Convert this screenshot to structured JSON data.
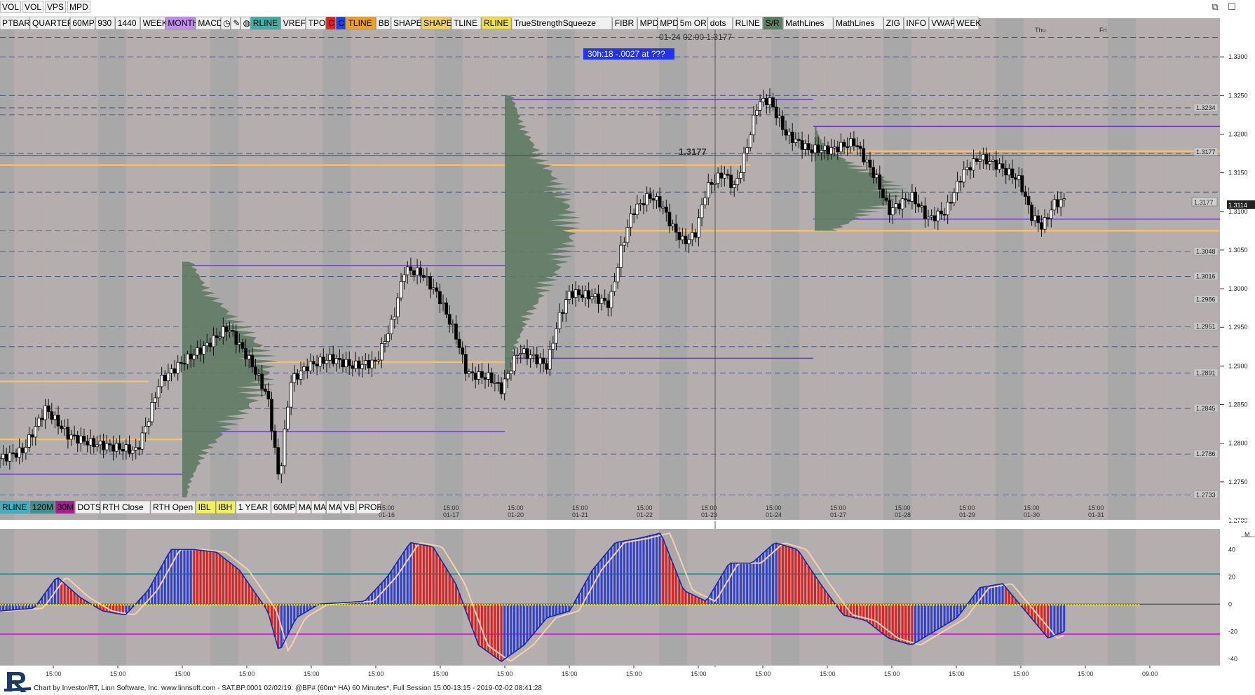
{
  "menubar": {
    "items": [
      "VOL",
      "VOL",
      "VPS",
      "MPD"
    ]
  },
  "toolbar_top": [
    {
      "label": "PTBAR",
      "bg": "#f0f0f0"
    },
    {
      "label": "QUARTER",
      "bg": "#f0f0f0"
    },
    {
      "label": "60MP",
      "bg": "#f0f0f0"
    },
    {
      "label": "930",
      "bg": "#f0f0f0"
    },
    {
      "label": "1440",
      "bg": "#f0f0f0"
    },
    {
      "label": "WEEK",
      "bg": "#f0f0f0"
    },
    {
      "label": "MONTH",
      "bg": "#c58cf0"
    },
    {
      "label": "MACD",
      "bg": "#f0f0f0"
    },
    {
      "label": "◷",
      "bg": "#f0f0f0"
    },
    {
      "label": "✎",
      "bg": "#f0f0f0"
    },
    {
      "label": "◍",
      "bg": "#f0f0f0"
    },
    {
      "label": "RLINE",
      "bg": "#3fb0a8"
    },
    {
      "label": "VREF",
      "bg": "#f0f0f0"
    },
    {
      "label": "TPO",
      "bg": "#f0f0f0"
    },
    {
      "label": "C",
      "bg": "#e02020"
    },
    {
      "label": "C",
      "bg": "#2040e0"
    },
    {
      "label": "TLINE",
      "bg": "#f0a020"
    },
    {
      "label": "BB",
      "bg": "#f0f0f0"
    },
    {
      "label": "SHAPE",
      "bg": "#f0f0f0"
    },
    {
      "label": "SHAPE",
      "bg": "#f0d060"
    },
    {
      "label": "TLINE",
      "bg": "#f0f0f0"
    },
    {
      "label": "RLINE",
      "bg": "#f0e040"
    },
    {
      "label": "TrueStrengthSqueeze",
      "bg": "#f0f0f0"
    },
    {
      "label": "FIBR",
      "bg": "#f0f0f0"
    },
    {
      "label": "MPD",
      "bg": "#f0f0f0"
    },
    {
      "label": "MPD",
      "bg": "#f0f0f0"
    },
    {
      "label": "5m OR",
      "bg": "#f0f0f0"
    },
    {
      "label": "dots",
      "bg": "#f0f0f0"
    },
    {
      "label": "RLINE",
      "bg": "#f0f0f0"
    },
    {
      "label": "S/R",
      "bg": "#5a8060"
    },
    {
      "label": "MathLines",
      "bg": "#f0f0f0"
    },
    {
      "label": "MathLines",
      "bg": "#f0f0f0"
    },
    {
      "label": "ZIG",
      "bg": "#f0f0f0"
    },
    {
      "label": "INFO",
      "bg": "#f0f0f0"
    },
    {
      "label": "VWAP",
      "bg": "#f0f0f0"
    },
    {
      "label": "WEEK",
      "bg": "#f0f0f0"
    }
  ],
  "toolbar_bottom": [
    {
      "label": "RLINE",
      "bg": "#3fb0c0"
    },
    {
      "label": "120M",
      "bg": "#3f9090"
    },
    {
      "label": "30M",
      "bg": "#a02090"
    },
    {
      "label": "DOTS",
      "bg": "#f0f0f0"
    },
    {
      "label": "RTH Close",
      "bg": "#f0f0f0"
    },
    {
      "label": "RTH Open",
      "bg": "#f0f0f0"
    },
    {
      "label": "IBL",
      "bg": "#f0f060"
    },
    {
      "label": "IBH",
      "bg": "#f0f060"
    },
    {
      "label": "1 YEAR",
      "bg": "#f0f0f0"
    },
    {
      "label": "60MP",
      "bg": "#f0f0f0"
    },
    {
      "label": "MA",
      "bg": "#f0f0f0"
    },
    {
      "label": "MA",
      "bg": "#f0f0f0"
    },
    {
      "label": "MA",
      "bg": "#f0f0f0"
    },
    {
      "label": "VB",
      "bg": "#f0f0f0"
    },
    {
      "label": "PROF",
      "bg": "#f0f0f0"
    }
  ],
  "crosshair_readout": "01-24  02:00  1.3177",
  "info_box": "30h:18  -.0027 at ???",
  "crosshair_price_label": "1.3177",
  "current_price_label": "1.3114",
  "colors": {
    "price_bg": "#b4aeae",
    "shade_band": "#a8a8a8",
    "profile": "#5f7a64",
    "orange_line": "#f2c070",
    "purple_line": "#6a3cc8",
    "macd_up": "#3040d0",
    "macd_down": "#e02020",
    "zero_dots": "#f0f000",
    "teal_level": "#2f8f8f",
    "magenta_level": "#e020e0"
  },
  "footer_text": "Chart by Investor/RT, Linn Software, Inc. www.linnsoft.com - SAT.BP.0001  02/02/19: @BP# (60m* HA) 60 Minutes*, Full Session 15:00-13:15 - 2019-02-02 08:41:28",
  "chart_data": [
    {
      "type": "candlestick",
      "title": "",
      "ylim": [
        1.27,
        1.335
      ],
      "y_ticks": [
        "1.3300",
        "1.3250",
        "1.3200",
        "1.3150",
        "1.3100",
        "1.3050",
        "1.3000",
        "1.2950",
        "1.2900",
        "1.2850",
        "1.2800",
        "1.2750",
        "1.2700"
      ],
      "session_labels": [
        {
          "time": "15:00",
          "date": "01-16"
        },
        {
          "time": "15:00",
          "date": "01-17"
        },
        {
          "time": "15:00",
          "date": "01-20"
        },
        {
          "time": "15:00",
          "date": "01-21"
        },
        {
          "time": "15:00",
          "date": "01-22"
        },
        {
          "time": "15:00",
          "date": "01-23"
        },
        {
          "time": "15:00",
          "date": "01-24"
        },
        {
          "time": "15:00",
          "date": "01-27"
        },
        {
          "time": "15:00",
          "date": "01-28"
        },
        {
          "time": "15:00",
          "date": "01-29"
        },
        {
          "time": "15:00",
          "date": "01-30"
        },
        {
          "time": "15:00",
          "date": "01-31"
        }
      ],
      "weekday_labels": [
        "Thu",
        "Fri"
      ],
      "level_labels": [
        "1.3234",
        "1.3177",
        "1.3114",
        "1.3048",
        "1.3016",
        "1.2986",
        "1.2951",
        "1.2891",
        "1.2845",
        "1.2786",
        "1.2733"
      ],
      "close_path": [
        [
          0,
          1.278
        ],
        [
          0.02,
          1.279
        ],
        [
          0.04,
          1.2845
        ],
        [
          0.06,
          1.281
        ],
        [
          0.08,
          1.28
        ],
        [
          0.1,
          1.2795
        ],
        [
          0.12,
          1.279
        ],
        [
          0.13,
          1.283
        ],
        [
          0.14,
          1.288
        ],
        [
          0.16,
          1.2905
        ],
        [
          0.18,
          1.2925
        ],
        [
          0.2,
          1.295
        ],
        [
          0.22,
          1.2905
        ],
        [
          0.235,
          1.286
        ],
        [
          0.245,
          1.275
        ],
        [
          0.255,
          1.288
        ],
        [
          0.27,
          1.29
        ],
        [
          0.29,
          1.291
        ],
        [
          0.31,
          1.29
        ],
        [
          0.33,
          1.2905
        ],
        [
          0.345,
          1.296
        ],
        [
          0.355,
          1.3025
        ],
        [
          0.37,
          1.302
        ],
        [
          0.385,
          1.299
        ],
        [
          0.4,
          1.294
        ],
        [
          0.41,
          1.289
        ],
        [
          0.43,
          1.2885
        ],
        [
          0.44,
          1.287
        ],
        [
          0.455,
          1.292
        ],
        [
          0.47,
          1.291
        ],
        [
          0.48,
          1.29
        ],
        [
          0.49,
          1.296
        ],
        [
          0.5,
          1.2995
        ],
        [
          0.52,
          1.299
        ],
        [
          0.535,
          1.298
        ],
        [
          0.545,
          1.305
        ],
        [
          0.555,
          1.31
        ],
        [
          0.57,
          1.312
        ],
        [
          0.58,
          1.311
        ],
        [
          0.59,
          1.308
        ],
        [
          0.6,
          1.306
        ],
        [
          0.61,
          1.307
        ],
        [
          0.62,
          1.313
        ],
        [
          0.635,
          1.315
        ],
        [
          0.645,
          1.313
        ],
        [
          0.655,
          1.318
        ],
        [
          0.665,
          1.324
        ],
        [
          0.675,
          1.3245
        ],
        [
          0.69,
          1.32
        ],
        [
          0.71,
          1.318
        ],
        [
          0.73,
          1.318
        ],
        [
          0.75,
          1.319
        ],
        [
          0.77,
          1.314
        ],
        [
          0.78,
          1.31
        ],
        [
          0.8,
          1.312
        ],
        [
          0.815,
          1.309
        ],
        [
          0.83,
          1.31
        ],
        [
          0.845,
          1.315
        ],
        [
          0.86,
          1.317
        ],
        [
          0.875,
          1.316
        ],
        [
          0.885,
          1.315
        ],
        [
          0.895,
          1.314
        ],
        [
          0.905,
          1.3095
        ],
        [
          0.915,
          1.308
        ],
        [
          0.925,
          1.311
        ],
        [
          0.934,
          1.3114
        ]
      ]
    },
    {
      "type": "bar",
      "title": "",
      "ylim": [
        -45,
        55
      ],
      "y_ticks": [
        "40",
        "20",
        "0",
        "-20",
        "-40"
      ],
      "levels": [
        22,
        -22
      ],
      "x_time_labels": [
        "15:00",
        "15:00",
        "15:00",
        "15:00",
        "15:00",
        "15:00",
        "15:00",
        "15:00",
        "15:00",
        "15:00",
        "15:00",
        "15:00",
        "15:00",
        "15:00",
        "15:00",
        "15:00",
        "15:00",
        "09:00"
      ],
      "series_path": [
        [
          0,
          -5
        ],
        [
          0.03,
          -3
        ],
        [
          0.05,
          20
        ],
        [
          0.07,
          5
        ],
        [
          0.09,
          -5
        ],
        [
          0.11,
          -8
        ],
        [
          0.13,
          10
        ],
        [
          0.15,
          40
        ],
        [
          0.17,
          40
        ],
        [
          0.19,
          38
        ],
        [
          0.21,
          25
        ],
        [
          0.235,
          -5
        ],
        [
          0.245,
          -35
        ],
        [
          0.26,
          -10
        ],
        [
          0.28,
          0
        ],
        [
          0.3,
          1
        ],
        [
          0.32,
          2
        ],
        [
          0.34,
          20
        ],
        [
          0.36,
          45
        ],
        [
          0.38,
          42
        ],
        [
          0.4,
          15
        ],
        [
          0.42,
          -30
        ],
        [
          0.44,
          -42
        ],
        [
          0.46,
          -30
        ],
        [
          0.48,
          -10
        ],
        [
          0.5,
          -5
        ],
        [
          0.52,
          25
        ],
        [
          0.54,
          45
        ],
        [
          0.56,
          48
        ],
        [
          0.58,
          52
        ],
        [
          0.6,
          10
        ],
        [
          0.62,
          2
        ],
        [
          0.64,
          30
        ],
        [
          0.66,
          30
        ],
        [
          0.68,
          45
        ],
        [
          0.7,
          40
        ],
        [
          0.72,
          15
        ],
        [
          0.74,
          -8
        ],
        [
          0.76,
          -12
        ],
        [
          0.78,
          -25
        ],
        [
          0.8,
          -30
        ],
        [
          0.82,
          -20
        ],
        [
          0.84,
          -10
        ],
        [
          0.86,
          12
        ],
        [
          0.88,
          15
        ],
        [
          0.9,
          -5
        ],
        [
          0.92,
          -25
        ],
        [
          0.934,
          -20
        ]
      ]
    }
  ]
}
